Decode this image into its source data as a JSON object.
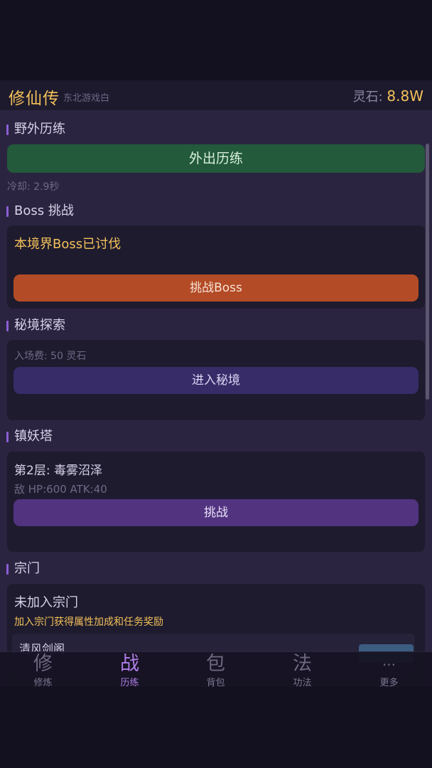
{
  "header": {
    "title": "修仙传",
    "subtitle": "东北游戏白",
    "stone_label": "灵石: ",
    "stone_value": "8.8W"
  },
  "wild": {
    "title": "野外历练",
    "button": "外出历练",
    "cooldown": "冷却: 2.9秒"
  },
  "boss": {
    "title": "Boss 挑战",
    "status": "本境界Boss已讨伐",
    "button": "挑战Boss"
  },
  "secret": {
    "title": "秘境探索",
    "fee": "入场费: 50 灵石",
    "button": "进入秘境"
  },
  "tower": {
    "title": "镇妖塔",
    "floor": "第2层: 毒雾沼泽",
    "enemy": "敌 HP:600 ATK:40",
    "button": "挑战"
  },
  "sect": {
    "title": "宗门",
    "status": "未加入宗门",
    "hint": "加入宗门获得属性加成和任务奖励",
    "first_sect": "清风剑阁"
  },
  "tabs": [
    {
      "glyph": "修",
      "label": "修炼"
    },
    {
      "glyph": "战",
      "label": "历练"
    },
    {
      "glyph": "包",
      "label": "背包"
    },
    {
      "glyph": "法",
      "label": "功法"
    },
    {
      "glyph": "...",
      "label": "更多"
    }
  ],
  "colors": {
    "accent_gold": "#f3c15a",
    "wild_button": "#235a3c",
    "boss_button": "#b34b26",
    "secret_button": "#372b68",
    "tower_button": "#513380",
    "active_tab": "#b07ee8"
  }
}
